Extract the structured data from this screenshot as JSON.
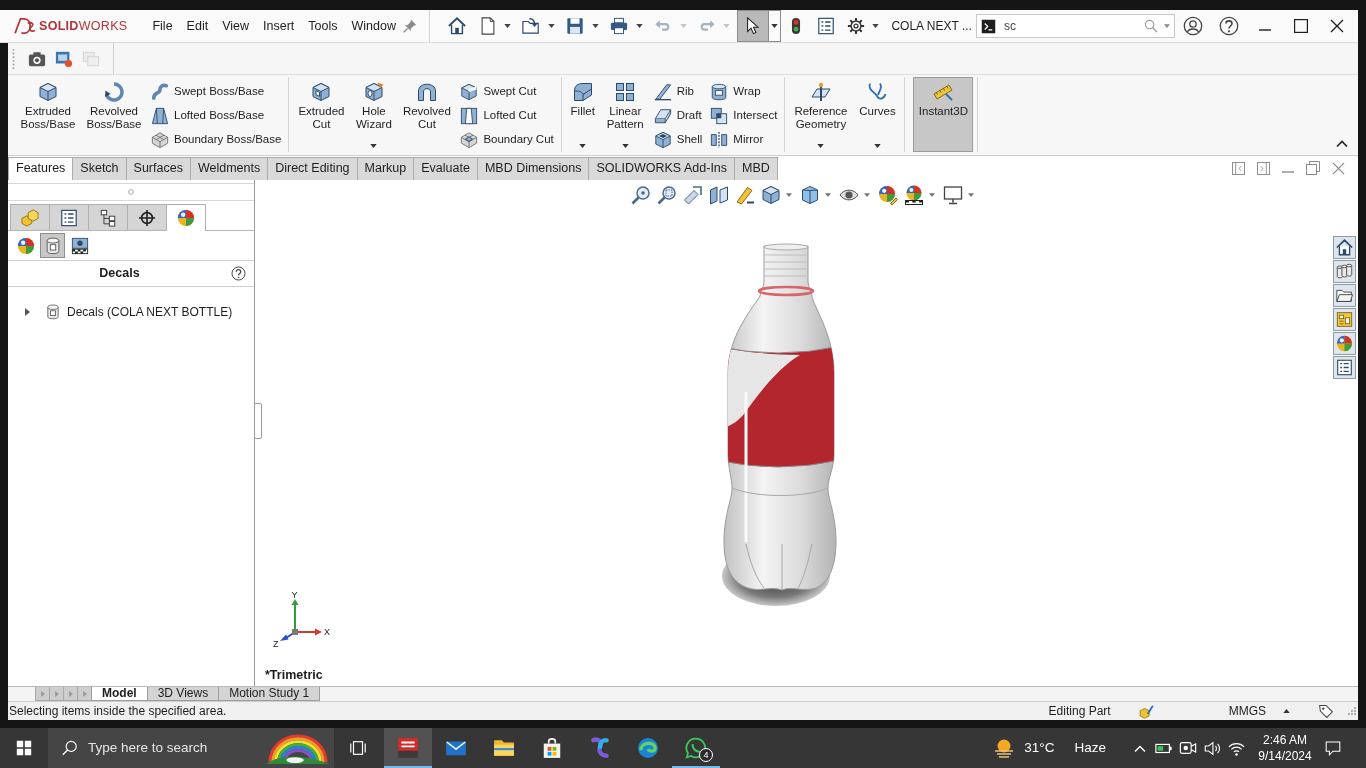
{
  "titlebar": {
    "brand": "**SOLID**WORKS",
    "menu": [
      "File",
      "Edit",
      "View",
      "Insert",
      "Tools",
      "Window"
    ],
    "tools": [
      {
        "disabled": false,
        "pressed": false
      },
      {
        "disabled": false,
        "pressed": false
      },
      {
        "disabled": false,
        "pressed": false
      },
      {
        "disabled": false,
        "pressed": false
      },
      {
        "disabled": false,
        "pressed": false
      },
      {
        "disabled": true,
        "pressed": false
      },
      {
        "disabled": true,
        "pressed": false
      },
      {
        "disabled": false,
        "pressed": true
      },
      {
        "disabled": false,
        "pressed": false
      },
      {
        "disabled": false,
        "pressed": false
      },
      {
        "disabled": false,
        "pressed": false
      }
    ],
    "document": "COLA NEXT ...",
    "search": {
      "value": "sc"
    }
  },
  "quick_toolbar": [
    {
      "disabled": false
    },
    {
      "disabled": false
    },
    {
      "disabled": true
    }
  ],
  "ribbon": [
    {
      "large": [
        {
          "label": "Extruded Boss/Base",
          "on": false
        },
        {
          "label": "Revolved Boss/Base",
          "on": false
        }
      ],
      "columns": [
        [
          "Swept Boss/Base",
          "Lofted Boss/Base",
          "Boundary Boss/Base"
        ]
      ]
    },
    {
      "large": [
        {
          "label": "Extruded Cut",
          "on": false
        },
        {
          "label": "Hole Wizard",
          "on": false
        },
        {
          "label": "Revolved Cut",
          "on": false
        }
      ],
      "columns": [
        [
          "Swept Cut",
          "Lofted Cut",
          "Boundary Cut"
        ]
      ]
    },
    {
      "large": [
        {
          "label": "Fillet",
          "on": false
        },
        {
          "label": "Linear Pattern",
          "on": false
        }
      ],
      "columns": [
        [
          "Rib",
          "Draft",
          "Shell"
        ],
        [
          "Wrap",
          "Intersect",
          "Mirror"
        ]
      ]
    },
    {
      "large": [
        {
          "label": "Reference Geometry",
          "on": false
        },
        {
          "label": "Curves",
          "on": false
        }
      ]
    },
    {
      "large": [
        {
          "label": "Instant3D",
          "on": true
        }
      ]
    }
  ],
  "tabs": [
    {
      "label": "Features",
      "selected": true
    },
    {
      "label": "Sketch",
      "selected": false
    },
    {
      "label": "Surfaces",
      "selected": false
    },
    {
      "label": "Weldments",
      "selected": false
    },
    {
      "label": "Direct Editing",
      "selected": false
    },
    {
      "label": "Markup",
      "selected": false
    },
    {
      "label": "Evaluate",
      "selected": false
    },
    {
      "label": "MBD Dimensions",
      "selected": false
    },
    {
      "label": "SOLIDWORKS Add-Ins",
      "selected": false
    },
    {
      "label": "MBD",
      "selected": false
    }
  ],
  "panel": {
    "tabs": [
      {
        "selected": false
      },
      {
        "selected": false
      },
      {
        "selected": false
      },
      {
        "selected": false
      },
      {
        "selected": true
      }
    ],
    "subtabs": [
      {
        "selected": false
      },
      {
        "selected": true
      },
      {
        "selected": false
      }
    ],
    "title": "Decals",
    "tree": [
      {
        "label": "Decals (COLA NEXT BOTTLE)",
        "expanded": false
      }
    ]
  },
  "viewport": {
    "view_name": "*Trimetric",
    "triad": {
      "y": "Y",
      "z": "Z",
      "x": "X"
    }
  },
  "bottom_tabs": [
    {
      "label": "Model",
      "selected": true
    },
    {
      "label": "3D Views",
      "selected": false
    },
    {
      "label": "Motion Study 1",
      "selected": false
    }
  ],
  "status_bar": {
    "message": "Selecting items inside the specified area.",
    "mode": "Editing Part",
    "units": "MMGS"
  },
  "taskbar": {
    "search": {
      "placeholder": "Type here to search"
    },
    "apps": [
      {
        "active": true,
        "running": true
      },
      {
        "active": false,
        "running": false
      },
      {
        "active": false,
        "running": false
      },
      {
        "active": false,
        "running": false
      },
      {
        "active": false,
        "running": false
      },
      {
        "active": false,
        "running": false
      },
      {
        "active": false,
        "running": true,
        "badge": "4"
      }
    ],
    "weather": {
      "temperature": "31°C",
      "condition": "Haze"
    },
    "time": "2:46 AM",
    "date": "9/14/2024"
  }
}
